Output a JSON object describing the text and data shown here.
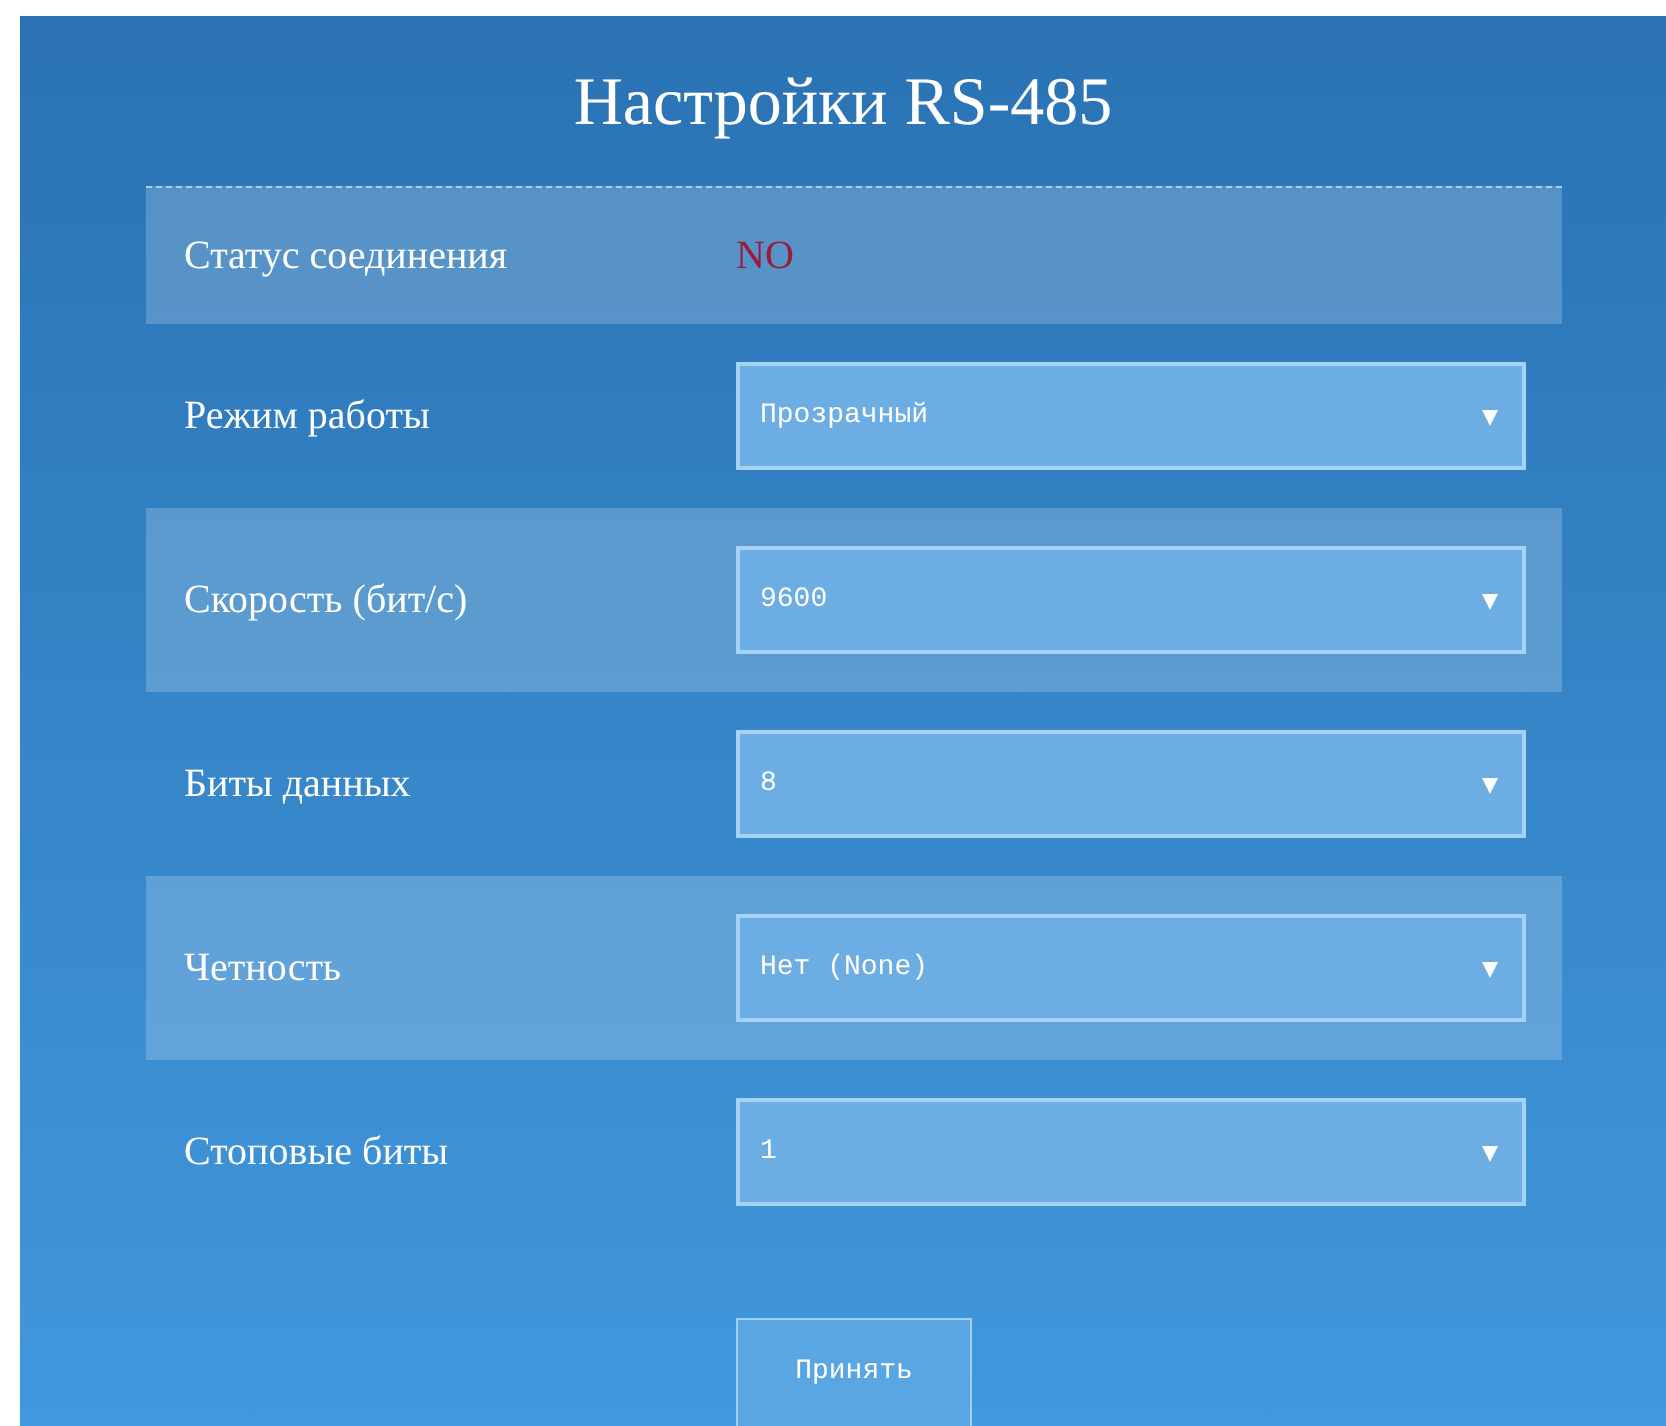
{
  "title": "Настройки RS-485",
  "status": {
    "label": "Статус соединения",
    "value": "NO"
  },
  "fields": [
    {
      "label": "Режим работы",
      "value": "Прозрачный"
    },
    {
      "label": "Скорость (бит/с)",
      "value": "9600"
    },
    {
      "label": "Биты данных",
      "value": "8"
    },
    {
      "label": "Четность",
      "value": "Нет (None)"
    },
    {
      "label": "Стоповые биты",
      "value": "1"
    }
  ],
  "button": "Принять"
}
